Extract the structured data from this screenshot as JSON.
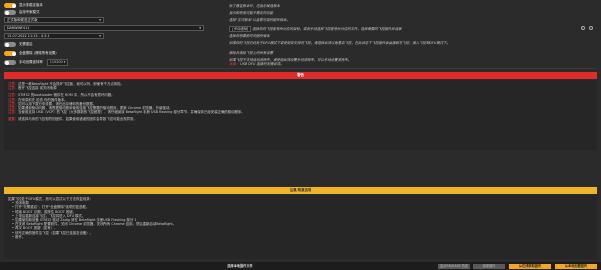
{
  "settings": {
    "show_dev_versions": {
      "label": "显示非稳定版本",
      "desc": "除了稳定版本外，还显示候选版本"
    },
    "expert_mode": {
      "label": "启用专家模式",
      "desc": "显示和使用可能不稳定的功能"
    },
    "firmware_type": {
      "value": "正式版和候选正式版",
      "desc": "选择\"正式版本\"以查看可用的固件版本。"
    },
    "board": {
      "value": "DARWINF411",
      "desc_prefix": "[手动选择]",
      "desc": "选择你的飞控型号所对应的目标，或者手动选择飞控型号所对应的文件，选择需要的飞控固件并烧录"
    },
    "version": {
      "value": "13-07-2022 11:13 - 4.3.1",
      "desc": "选择你想要刷写的固件版本"
    },
    "no_reboot": {
      "label": "无需重启",
      "desc": "如果你的飞控已经处于DFU模式下或使用仅支持的飞控，请选择此项以免重启飞控，在此状态下飞控固件会直接刷写飞控，接入飞控到DFU模式下。"
    },
    "full_erase": {
      "label": "全盘擦除 (清除所有设置)",
      "desc": "擦除并清除飞控上的所有设置"
    },
    "manual_baud": {
      "label": "手动设置波特率",
      "value": "115200",
      "desc_prefix": "如果飞控不支持自动波特率，请使用此项设置手动波特率，可以手动设置波特率。",
      "desc_warn": "注意：",
      "desc": "USB DFU 连接时无需此项。"
    }
  },
  "warning_banner": {
    "title": "警告"
  },
  "warnings": [
    {
      "prefix": "注意：",
      "text": "这是一款Betaflight 不会损坏飞控板，我可以吗，即使有千万点风险。"
    },
    {
      "prefix": "注意：",
      "text": "断开飞控连接 或关闭电源"
    },
    {
      "prefix": "注意：",
      "text": "STM32 的bootloader 储存在 ROM 中，所以不会有损坏问题。"
    },
    {
      "prefix": "注意：",
      "text": "在烧录前先 检查 你的固件版本。"
    },
    {
      "prefix": "注意：",
      "text": "如可以用下载分享设置，请在此存储你的备份数据。"
    },
    {
      "prefix": "注意：",
      "text": "如果遇到驱动问题，请根据驱动程序使用连接飞控需要的驱动程序，更新 Chrome 浏览器，升级驱动。"
    },
    {
      "prefix": "注意：",
      "text": "当使用支持 USB（VCP）的飞控（大多数新的飞控都是），请仔细阅读 Betaflight 手册 USB flashing 部分章节，并确保你已经安装正确的驱动程序。"
    },
    {
      "prefix": "重要：",
      "text": "请选择与你的飞控相符的固件，如果使用错误的固件会导致飞控可能出现异常。"
    }
  ],
  "notice_banner": {
    "title": "注意/恢复选项"
  },
  "notices_intro": "如果飞控处于DFU模式，则可以尝试以下方法恢复烧录：",
  "notices": [
    "关闭电源",
    "打开\"无需重启\"，打开\"全盘擦除\"选项的复选框。",
    "短接 BOOT 引脚，或按住 BOOT 按键。",
    "上电后重新连接飞控，飞控将进入 DFU 模式。",
    "如果使用新设备 STM32 驱动 Zadig 请在 Betaflight 手册USB Flashing 部分 1",
    "在关闭 Betaflight 配置软件，关闭 Chrome 浏览器，关闭所有 Chrome 应用，然后重新启动Betaflight。",
    "再次 BOOT 按键（如有），",
    "烧写正确的固件至飞控（如果飞控已连接至设备）。",
    "断开。"
  ],
  "footer": {
    "load_file": "选择本地固件文件",
    "btn_online": "从在线获取固件",
    "btn_local": "从本地加载固件",
    "btn_flash_disabled_1": "显示RELEASE 历史",
    "btn_flash_disabled_2": "烧录固件"
  },
  "colors": {
    "accent": "#f5a623",
    "warning": "#e02b2b",
    "notice": "#f0b428"
  }
}
